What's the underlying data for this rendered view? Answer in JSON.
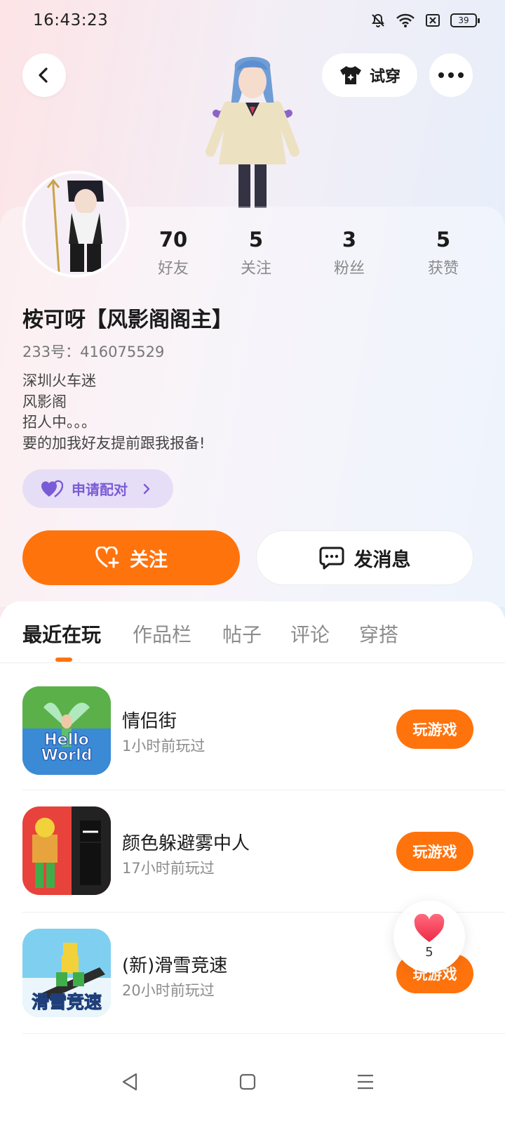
{
  "status_bar": {
    "time": "16:43:23",
    "battery": "39"
  },
  "header": {
    "tryon_label": "试穿"
  },
  "profile": {
    "stats": [
      {
        "value": "70",
        "label": "好友"
      },
      {
        "value": "5",
        "label": "关注"
      },
      {
        "value": "3",
        "label": "粉丝"
      },
      {
        "value": "5",
        "label": "获赞"
      }
    ],
    "nickname": "桉可呀【风影阁阁主】",
    "uid": "233号：416075529",
    "bio": [
      "深圳火车迷",
      "风影阁",
      "招人中。。。",
      "要的加我好友提前跟我报备!"
    ],
    "pair_label": "申请配对"
  },
  "actions": {
    "follow_label": "关注",
    "message_label": "发消息"
  },
  "tabs": [
    {
      "label": "最近在玩"
    },
    {
      "label": "作品栏"
    },
    {
      "label": "帖子"
    },
    {
      "label": "评论"
    },
    {
      "label": "穿搭"
    }
  ],
  "games": [
    {
      "title": "情侣街",
      "time": "1小时前玩过",
      "button": "玩游戏",
      "thumb_text": "Hello World"
    },
    {
      "title": "颜色躲避雾中人",
      "time": "17小时前玩过",
      "button": "玩游戏"
    },
    {
      "title": "(新)滑雪竞速",
      "time": "20小时前玩过",
      "button": "玩游戏",
      "thumb_text": "滑雪竞速"
    }
  ],
  "like_bubble": {
    "count": "5"
  },
  "colors": {
    "accent": "#ff730d",
    "pair": "#7a5bd6",
    "pair_bg": "#e6def7"
  }
}
